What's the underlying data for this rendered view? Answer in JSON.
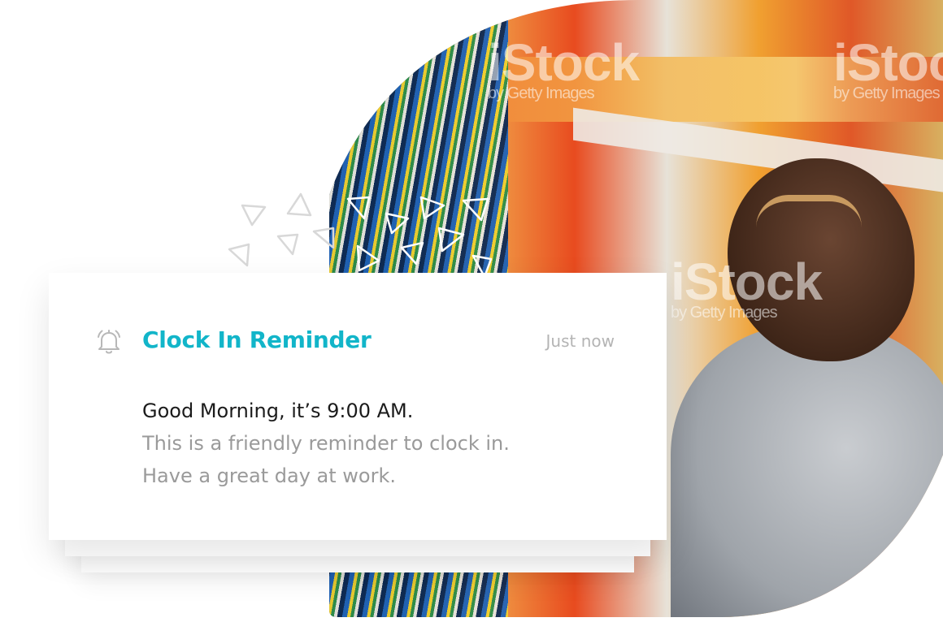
{
  "notification": {
    "title": "Clock In Reminder",
    "time": "Just now",
    "greeting": "Good Morning, it’s 9:00 AM.",
    "line1": "This is a friendly reminder to clock in.",
    "line2": "Have a great day at work.",
    "icon": "bell-icon",
    "accent_color": "#12b5c9"
  },
  "photo": {
    "watermark": "iStock",
    "watermark_sub": "by Getty Images"
  }
}
